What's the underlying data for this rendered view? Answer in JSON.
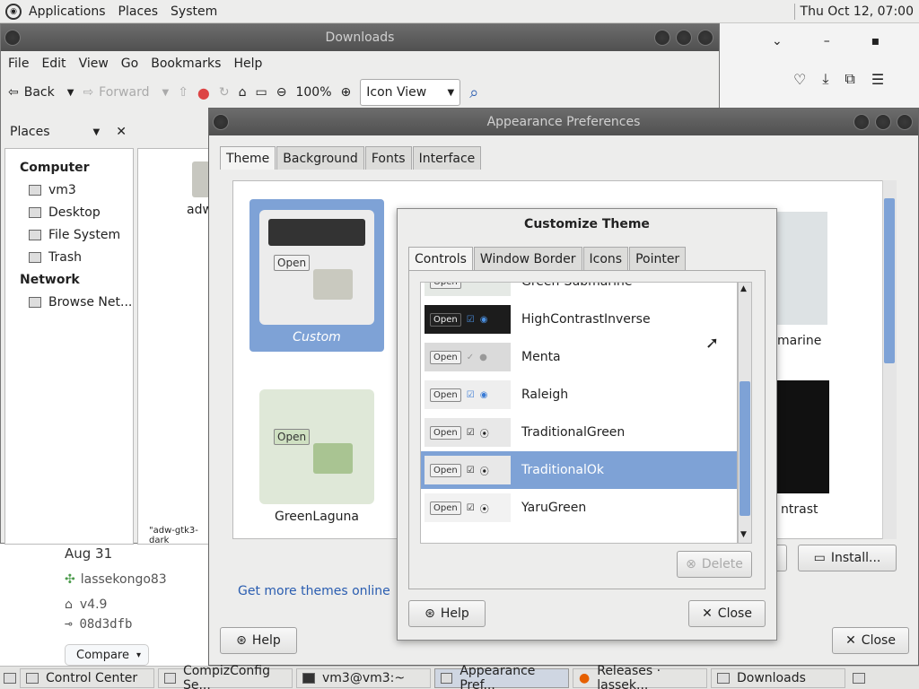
{
  "top_panel": {
    "menus": [
      "Applications",
      "Places",
      "System"
    ],
    "clock": "Thu Oct 12, 07:00"
  },
  "downloads_window": {
    "title": "Downloads",
    "menubar": [
      "File",
      "Edit",
      "View",
      "Go",
      "Bookmarks",
      "Help"
    ],
    "toolbar": {
      "back": "Back",
      "forward": "Forward",
      "zoom": "100%",
      "view_mode": "Icon View"
    },
    "places_label": "Places",
    "sidebar": {
      "computer_heading": "Computer",
      "computer_items": [
        "vm3",
        "Desktop",
        "File System",
        "Trash"
      ],
      "network_heading": "Network",
      "network_items": [
        "Browse Net..."
      ]
    },
    "file_label": "adw",
    "status": "\"adw-gtk3-dark"
  },
  "github_bg": {
    "date": "Aug 31",
    "user": "lassekongo83",
    "tag": "v4.9",
    "commit": "08d3dfb",
    "compare": "Compare"
  },
  "appearance_window": {
    "title": "Appearance Preferences",
    "tabs": [
      "Theme",
      "Background",
      "Fonts",
      "Interface"
    ],
    "themes": {
      "custom": "Custom",
      "greenlaguna": "GreenLaguna",
      "submarine_partial": "marine",
      "contrast_partial": "ntrast"
    },
    "get_more_link": "Get more themes online",
    "install_button": "Install...",
    "help_button": "Help",
    "close_button": "Close"
  },
  "customize_dialog": {
    "title": "Customize Theme",
    "tabs": [
      "Controls",
      "Window Border",
      "Icons",
      "Pointer"
    ],
    "rows": [
      {
        "name": "Green-Submarine",
        "style": "light"
      },
      {
        "name": "HighContrastInverse",
        "style": "dark"
      },
      {
        "name": "Menta",
        "style": "grey"
      },
      {
        "name": "Raleigh",
        "style": "blue"
      },
      {
        "name": "TraditionalGreen",
        "style": "light"
      },
      {
        "name": "TraditionalOk",
        "style": "light"
      },
      {
        "name": "YaruGreen",
        "style": "light"
      }
    ],
    "selected": "TraditionalOk",
    "open_label": "Open",
    "delete_button": "Delete",
    "help_button": "Help",
    "close_button": "Close"
  },
  "taskbar": {
    "items": [
      "Control Center",
      "CompizConfig Se...",
      "vm3@vm3:~",
      "Appearance Pref...",
      "Releases · lassek...",
      "Downloads"
    ]
  }
}
